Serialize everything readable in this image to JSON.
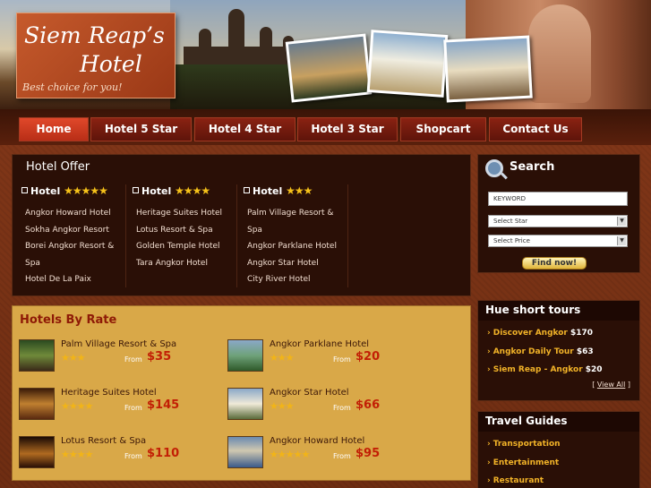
{
  "logo": {
    "line1": "Siem Reap’s",
    "line2": "Hotel",
    "tagline": "Best choice for you!"
  },
  "nav": [
    {
      "label": "Home",
      "active": true
    },
    {
      "label": "Hotel 5 Star"
    },
    {
      "label": "Hotel 4 Star"
    },
    {
      "label": "Hotel 3 Star"
    },
    {
      "label": "Shopcart"
    },
    {
      "label": "Contact Us"
    }
  ],
  "offer": {
    "title": "Hotel Offer",
    "columns": [
      {
        "label": "Hotel",
        "stars": "★★★★★",
        "items": [
          "Angkor Howard Hotel",
          "Sokha Angkor Resort",
          "Borei Angkor Resort &",
          "Spa",
          "Hotel De La Paix"
        ]
      },
      {
        "label": "Hotel",
        "stars": "★★★★",
        "items": [
          "Heritage Suites Hotel",
          "Lotus Resort & Spa",
          "Golden Temple Hotel",
          "Tara Angkor Hotel"
        ]
      },
      {
        "label": "Hotel",
        "stars": "★★★",
        "items": [
          "Palm Village Resort &",
          "Spa",
          "Angkor Parklane Hotel",
          "Angkor Star Hotel",
          "City River Hotel"
        ]
      }
    ]
  },
  "rate": {
    "title": "Hotels By Rate",
    "from_label": "From",
    "items": [
      {
        "name": "Palm Village Resort & Spa",
        "stars": "★★★",
        "price": "$35"
      },
      {
        "name": "Angkor Parklane Hotel",
        "stars": "★★★",
        "price": "$20"
      },
      {
        "name": "Heritage Suites Hotel",
        "stars": "★★★★",
        "price": "$145"
      },
      {
        "name": "Angkor Star Hotel",
        "stars": "★★★",
        "price": "$66"
      },
      {
        "name": "Lotus Resort & Spa",
        "stars": "★★★★",
        "price": "$110"
      },
      {
        "name": "Angkor Howard Hotel",
        "stars": "★★★★★",
        "price": "$95"
      }
    ]
  },
  "search": {
    "title": "Search",
    "keyword_placeholder": "KEYWORD",
    "star_select": "Select Star",
    "price_select": "Select Price",
    "button": "Find now!"
  },
  "tours": {
    "title": "Hue short tours",
    "items": [
      {
        "name": "Discover Angkor",
        "price": "$170"
      },
      {
        "name": "Angkor Daily Tour",
        "price": "$63"
      },
      {
        "name": "Siem Reap - Angkor",
        "price": "$20"
      }
    ],
    "view_all": "View All"
  },
  "guides": {
    "title": "Travel Guides",
    "items": [
      "Transportation",
      "Entertainment",
      "Restaurant"
    ]
  }
}
